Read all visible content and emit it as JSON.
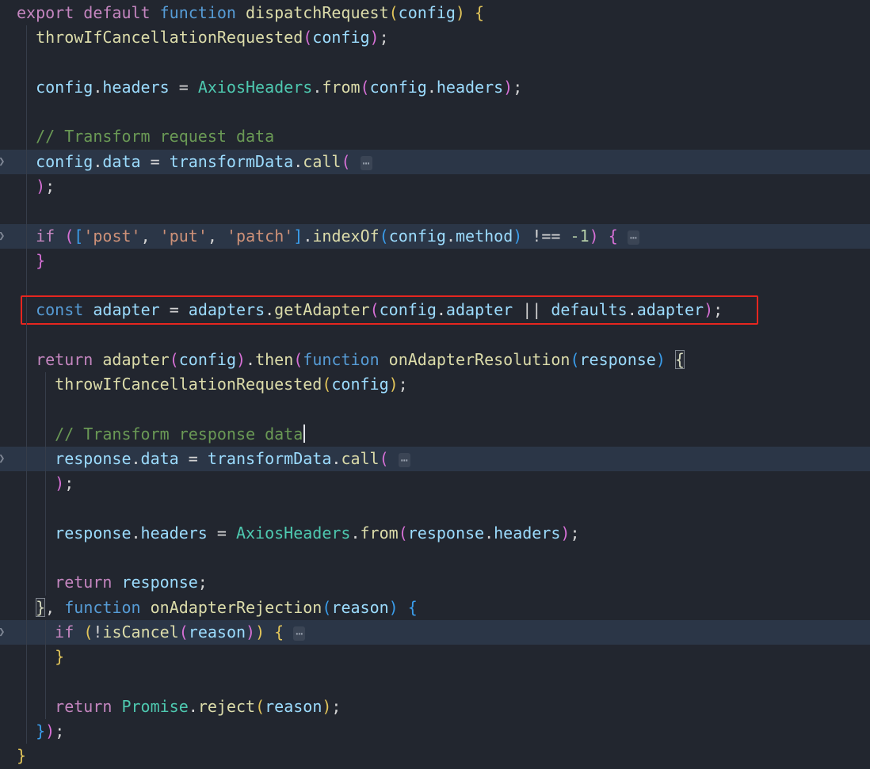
{
  "colors": {
    "background": "#22262f",
    "line_highlight": "#2b3647",
    "keyword": "#C586C0",
    "keyword2": "#569CD6",
    "function": "#DCDCAA",
    "variable": "#9CDCFE",
    "class": "#4EC9B0",
    "string": "#CE9178",
    "comment": "#6A9955",
    "number": "#B5CEA8",
    "operator": "#D4D4D4",
    "bracket1": "#E2C55A",
    "bracket2": "#D670D6",
    "bracket3": "#3A9DEB",
    "fold": "#9BA3B0",
    "guide": "#363D4A",
    "chevron": "#7F8795",
    "match_bracket": "#D8DCC0",
    "match_border": "#80868F",
    "annotation": "#E6261F",
    "caret": "#E0E3E8"
  },
  "editor": {
    "language": "javascript",
    "chevron_glyph": "❯",
    "fold_glyph": "⋯",
    "lines": [
      {
        "guides": 0,
        "tokens": [
          [
            "export default",
            "kw"
          ],
          [
            " ",
            ""
          ],
          [
            "function",
            "kb"
          ],
          [
            " ",
            ""
          ],
          [
            "dispatchRequest",
            "fn"
          ],
          [
            "(",
            "b1"
          ],
          [
            "config",
            "var"
          ],
          [
            ")",
            "b1"
          ],
          [
            " ",
            ""
          ],
          [
            "{",
            "b1"
          ]
        ]
      },
      {
        "guides": 1,
        "tokens": [
          [
            "  ",
            ""
          ],
          [
            "throwIfCancellationRequested",
            "fn"
          ],
          [
            "(",
            "b2"
          ],
          [
            "config",
            "var"
          ],
          [
            ")",
            "b2"
          ],
          [
            ";",
            "op"
          ]
        ]
      },
      {
        "guides": 1,
        "tokens": []
      },
      {
        "guides": 1,
        "tokens": [
          [
            "  ",
            ""
          ],
          [
            "config",
            "var"
          ],
          [
            ".",
            "op"
          ],
          [
            "headers",
            "var"
          ],
          [
            " = ",
            "op"
          ],
          [
            "AxiosHeaders",
            "cls"
          ],
          [
            ".",
            "op"
          ],
          [
            "from",
            "fn"
          ],
          [
            "(",
            "b2"
          ],
          [
            "config",
            "var"
          ],
          [
            ".",
            "op"
          ],
          [
            "headers",
            "var"
          ],
          [
            ")",
            "b2"
          ],
          [
            ";",
            "op"
          ]
        ]
      },
      {
        "guides": 1,
        "tokens": []
      },
      {
        "guides": 1,
        "tokens": [
          [
            "  ",
            ""
          ],
          [
            "// Transform request data",
            "com"
          ]
        ]
      },
      {
        "guides": 1,
        "hl": true,
        "chev": true,
        "tokens": [
          [
            "  ",
            ""
          ],
          [
            "config",
            "var"
          ],
          [
            ".",
            "op"
          ],
          [
            "data",
            "var"
          ],
          [
            " = ",
            "op"
          ],
          [
            "transformData",
            "var"
          ],
          [
            ".",
            "op"
          ],
          [
            "call",
            "fn"
          ],
          [
            "(",
            "b2"
          ],
          [
            " ",
            ""
          ],
          [
            "⋯",
            "fold"
          ]
        ]
      },
      {
        "guides": 1,
        "tokens": [
          [
            "  ",
            ""
          ],
          [
            ")",
            "b2"
          ],
          [
            ";",
            "op"
          ]
        ]
      },
      {
        "guides": 1,
        "tokens": []
      },
      {
        "guides": 1,
        "hl": true,
        "chev": true,
        "tokens": [
          [
            "  ",
            ""
          ],
          [
            "if",
            "kw"
          ],
          [
            " ",
            ""
          ],
          [
            "(",
            "b2"
          ],
          [
            "[",
            "b3"
          ],
          [
            "'post'",
            "str"
          ],
          [
            ", ",
            "op"
          ],
          [
            "'put'",
            "str"
          ],
          [
            ", ",
            "op"
          ],
          [
            "'patch'",
            "str"
          ],
          [
            "]",
            "b3"
          ],
          [
            ".",
            "op"
          ],
          [
            "indexOf",
            "fn"
          ],
          [
            "(",
            "b3"
          ],
          [
            "config",
            "var"
          ],
          [
            ".",
            "op"
          ],
          [
            "method",
            "var"
          ],
          [
            ")",
            "b3"
          ],
          [
            " !== ",
            "op"
          ],
          [
            "-1",
            "num"
          ],
          [
            ")",
            "b2"
          ],
          [
            " ",
            ""
          ],
          [
            "{",
            "b2"
          ],
          [
            " ",
            ""
          ],
          [
            "⋯",
            "fold"
          ]
        ]
      },
      {
        "guides": 1,
        "tokens": [
          [
            "  ",
            ""
          ],
          [
            "}",
            "b2"
          ]
        ]
      },
      {
        "guides": 1,
        "tokens": []
      },
      {
        "guides": 1,
        "redbox": true,
        "tokens": [
          [
            "  ",
            ""
          ],
          [
            "const",
            "kb"
          ],
          [
            " ",
            ""
          ],
          [
            "adapter",
            "var"
          ],
          [
            " = ",
            "op"
          ],
          [
            "adapters",
            "var"
          ],
          [
            ".",
            "op"
          ],
          [
            "getAdapter",
            "fn"
          ],
          [
            "(",
            "b2"
          ],
          [
            "config",
            "var"
          ],
          [
            ".",
            "op"
          ],
          [
            "adapter",
            "var"
          ],
          [
            " || ",
            "op"
          ],
          [
            "defaults",
            "var"
          ],
          [
            ".",
            "op"
          ],
          [
            "adapter",
            "var"
          ],
          [
            ")",
            "b2"
          ],
          [
            ";",
            "op"
          ]
        ]
      },
      {
        "guides": 1,
        "tokens": []
      },
      {
        "guides": 1,
        "tokens": [
          [
            "  ",
            ""
          ],
          [
            "return",
            "kw"
          ],
          [
            " ",
            ""
          ],
          [
            "adapter",
            "fn"
          ],
          [
            "(",
            "b2"
          ],
          [
            "config",
            "var"
          ],
          [
            ")",
            "b2"
          ],
          [
            ".",
            "op"
          ],
          [
            "then",
            "fn"
          ],
          [
            "(",
            "b2"
          ],
          [
            "function",
            "kb"
          ],
          [
            " ",
            ""
          ],
          [
            "onAdapterResolution",
            "fn"
          ],
          [
            "(",
            "b3"
          ],
          [
            "response",
            "var"
          ],
          [
            ")",
            "b3"
          ],
          [
            " ",
            ""
          ],
          [
            "{",
            "box"
          ]
        ]
      },
      {
        "guides": 2,
        "tokens": [
          [
            "    ",
            ""
          ],
          [
            "throwIfCancellationRequested",
            "fn"
          ],
          [
            "(",
            "b1"
          ],
          [
            "config",
            "var"
          ],
          [
            ")",
            "b1"
          ],
          [
            ";",
            "op"
          ]
        ]
      },
      {
        "guides": 2,
        "tokens": []
      },
      {
        "guides": 2,
        "tokens": [
          [
            "    ",
            ""
          ],
          [
            "// Transform response data",
            "com"
          ],
          [
            "",
            "caret"
          ]
        ]
      },
      {
        "guides": 2,
        "hl": true,
        "chev": true,
        "tokens": [
          [
            "    ",
            ""
          ],
          [
            "response",
            "var"
          ],
          [
            ".",
            "op"
          ],
          [
            "data",
            "var"
          ],
          [
            " = ",
            "op"
          ],
          [
            "transformData",
            "var"
          ],
          [
            ".",
            "op"
          ],
          [
            "call",
            "fn"
          ],
          [
            "(",
            "b2"
          ],
          [
            " ",
            ""
          ],
          [
            "⋯",
            "fold"
          ]
        ]
      },
      {
        "guides": 2,
        "tokens": [
          [
            "    ",
            ""
          ],
          [
            ")",
            "b2"
          ],
          [
            ";",
            "op"
          ]
        ]
      },
      {
        "guides": 2,
        "tokens": []
      },
      {
        "guides": 2,
        "tokens": [
          [
            "    ",
            ""
          ],
          [
            "response",
            "var"
          ],
          [
            ".",
            "op"
          ],
          [
            "headers",
            "var"
          ],
          [
            " = ",
            "op"
          ],
          [
            "AxiosHeaders",
            "cls"
          ],
          [
            ".",
            "op"
          ],
          [
            "from",
            "fn"
          ],
          [
            "(",
            "b2"
          ],
          [
            "response",
            "var"
          ],
          [
            ".",
            "op"
          ],
          [
            "headers",
            "var"
          ],
          [
            ")",
            "b2"
          ],
          [
            ";",
            "op"
          ]
        ]
      },
      {
        "guides": 2,
        "tokens": []
      },
      {
        "guides": 2,
        "tokens": [
          [
            "    ",
            ""
          ],
          [
            "return",
            "kw"
          ],
          [
            " ",
            ""
          ],
          [
            "response",
            "var"
          ],
          [
            ";",
            "op"
          ]
        ]
      },
      {
        "guides": 1,
        "tokens": [
          [
            "  ",
            ""
          ],
          [
            "}",
            "box"
          ],
          [
            ", ",
            "op"
          ],
          [
            "function",
            "kb"
          ],
          [
            " ",
            ""
          ],
          [
            "onAdapterRejection",
            "fn"
          ],
          [
            "(",
            "b3"
          ],
          [
            "reason",
            "var"
          ],
          [
            ")",
            "b3"
          ],
          [
            " ",
            ""
          ],
          [
            "{",
            "b3"
          ]
        ]
      },
      {
        "guides": 2,
        "hl": true,
        "chev": true,
        "tokens": [
          [
            "    ",
            ""
          ],
          [
            "if",
            "kw"
          ],
          [
            " ",
            ""
          ],
          [
            "(",
            "b1"
          ],
          [
            "!",
            "op"
          ],
          [
            "isCancel",
            "fn"
          ],
          [
            "(",
            "b2"
          ],
          [
            "reason",
            "var"
          ],
          [
            ")",
            "b2"
          ],
          [
            ")",
            "b1"
          ],
          [
            " ",
            ""
          ],
          [
            "{",
            "b1"
          ],
          [
            " ",
            ""
          ],
          [
            "⋯",
            "fold"
          ]
        ]
      },
      {
        "guides": 2,
        "tokens": [
          [
            "    ",
            ""
          ],
          [
            "}",
            "b1"
          ]
        ]
      },
      {
        "guides": 2,
        "tokens": []
      },
      {
        "guides": 2,
        "tokens": [
          [
            "    ",
            ""
          ],
          [
            "return",
            "kw"
          ],
          [
            " ",
            ""
          ],
          [
            "Promise",
            "cls"
          ],
          [
            ".",
            "op"
          ],
          [
            "reject",
            "fn"
          ],
          [
            "(",
            "b1"
          ],
          [
            "reason",
            "var"
          ],
          [
            ")",
            "b1"
          ],
          [
            ";",
            "op"
          ]
        ]
      },
      {
        "guides": 1,
        "tokens": [
          [
            "  ",
            ""
          ],
          [
            "}",
            "b3"
          ],
          [
            ")",
            "b2"
          ],
          [
            ";",
            "op"
          ]
        ]
      },
      {
        "guides": 0,
        "tokens": [
          [
            "}",
            "b1"
          ]
        ]
      }
    ]
  }
}
